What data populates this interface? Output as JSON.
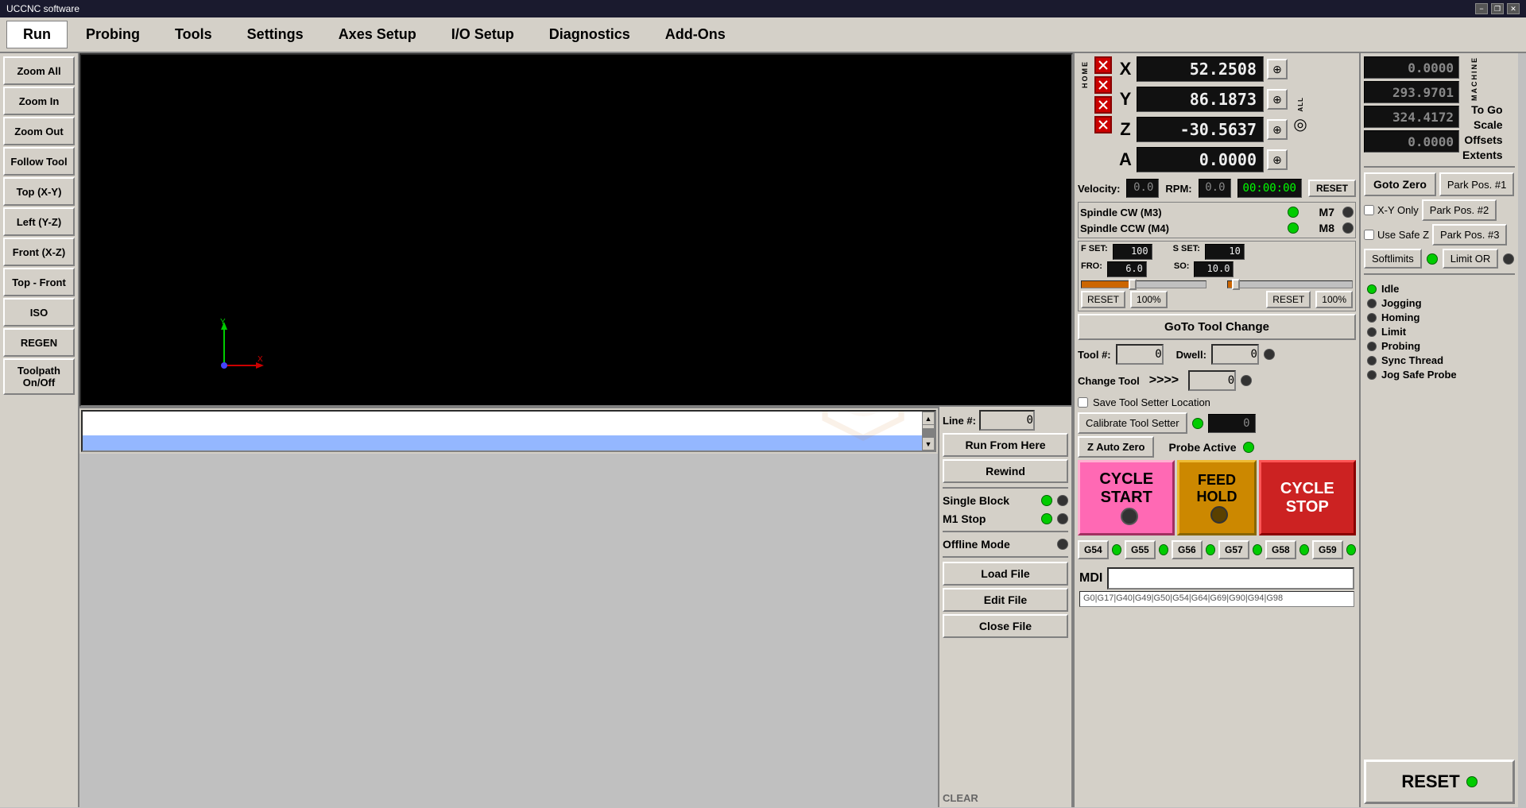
{
  "titlebar": {
    "title": "UCCNC software",
    "minimize": "−",
    "restore": "❐",
    "close": "✕"
  },
  "menu": {
    "items": [
      "Run",
      "Probing",
      "Tools",
      "Settings",
      "Axes Setup",
      "I/O Setup",
      "Diagnostics",
      "Add-Ons"
    ],
    "active": "Run"
  },
  "sidebar": {
    "buttons": [
      "Zoom All",
      "Zoom In",
      "Zoom Out",
      "Follow Tool",
      "Top (X-Y)",
      "Left (Y-Z)",
      "Front (X-Z)",
      "Top - Front",
      "ISO",
      "REGEN",
      "Toolpath On/Off"
    ]
  },
  "axes": {
    "home_labels": [
      "H",
      "O",
      "M",
      "E"
    ],
    "all_label": "HOME ALL",
    "rows": [
      {
        "axis": "X",
        "value": "52.2508",
        "machine": "0.0000"
      },
      {
        "axis": "Y",
        "value": "86.1873",
        "machine": "293.9701"
      },
      {
        "axis": "Z",
        "value": "-30.5637",
        "machine": "324.4172"
      },
      {
        "axis": "A",
        "value": "0.0000",
        "machine": "0.0000"
      }
    ],
    "machine_label": "MACHINE",
    "togo_label": "To Go",
    "scale_label": "Scale",
    "offsets_label": "Offsets",
    "extents_label": "Extents"
  },
  "velocity": {
    "label": "Velocity:",
    "value": "0.0",
    "rpm_label": "RPM:",
    "rpm_value": "0.0",
    "timer": "00:00:00",
    "reset_label": "RESET"
  },
  "spindle": {
    "cw_label": "Spindle CW (M3)",
    "ccw_label": "Spindle CCW (M4)",
    "m7_label": "M7",
    "m8_label": "M8"
  },
  "overrides": {
    "fset_label": "F SET:",
    "fset_value": "100",
    "sset_label": "S SET:",
    "sset_value": "10",
    "fro_label": "FRO:",
    "fro_value": "6.0",
    "so_label": "SO:",
    "so_value": "10.0",
    "reset_label": "RESET",
    "pct1": "100%",
    "reset2_label": "RESET",
    "pct2": "100%"
  },
  "tool_section": {
    "goto_tool_change": "GoTo Tool Change",
    "tool_num_label": "Tool #:",
    "tool_num_value": "0",
    "dwell_label": "Dwell:",
    "dwell_value": "0",
    "change_tool_label": "Change Tool",
    "arrows": ">>>>",
    "change_tool_value": "0",
    "save_tool_setter": "Save Tool Setter Location",
    "calibrate_btn": "Calibrate Tool Setter",
    "z_auto_zero": "Z Auto Zero",
    "probe_active": "Probe Active"
  },
  "code_controls": {
    "line_label": "Line #:",
    "line_value": "0",
    "run_from_here": "Run From Here",
    "rewind": "Rewind",
    "single_block": "Single Block",
    "m1_stop": "M1 Stop",
    "offline_mode": "Offline Mode",
    "load_file": "Load File",
    "edit_file": "Edit File",
    "close_file": "Close File",
    "clear": "CLEAR"
  },
  "cycle_buttons": {
    "start": "CYCLE\nSTART",
    "feed_hold": "FEED\nHOLD",
    "stop": "CYCLE\nSTOP"
  },
  "g_codes": {
    "codes": [
      "G54",
      "G55",
      "G56",
      "G57",
      "G58",
      "G59"
    ]
  },
  "mdi": {
    "label": "MDI",
    "history": "G0|G17|G40|G49|G50|G54|G64|G69|G90|G94|G98"
  },
  "right_panel": {
    "goto_zero": "Goto Zero",
    "xy_only_label": "X-Y Only",
    "use_safe_z": "Use Safe Z",
    "park1": "Park Pos. #1",
    "park2": "Park Pos. #2",
    "park3": "Park Pos. #3",
    "softlimits": "Softlimits",
    "limit_or": "Limit OR",
    "status": {
      "idle": "Idle",
      "jogging": "Jogging",
      "homing": "Homing",
      "limit": "Limit",
      "probing": "Probing",
      "sync_thread": "Sync Thread",
      "jog_safe_probe": "Jog Safe Probe"
    },
    "reset": "RESET"
  }
}
